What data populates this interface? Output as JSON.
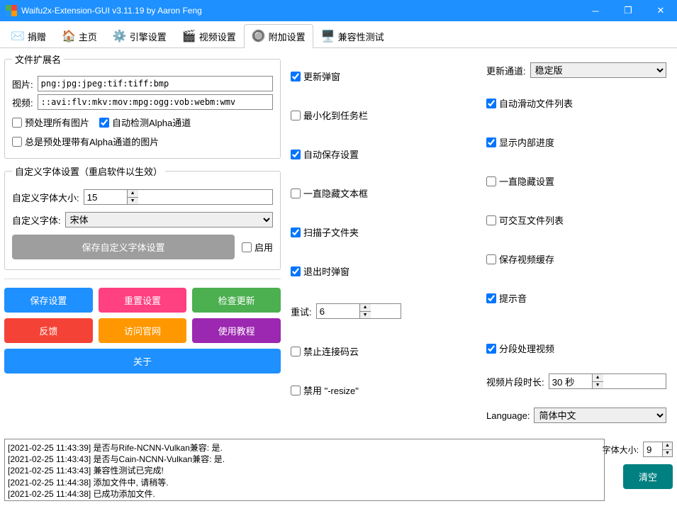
{
  "window": {
    "title": "Waifu2x-Extension-GUI v3.11.19 by Aaron Feng"
  },
  "tabs": {
    "donate": "捐赠",
    "home": "主页",
    "engine": "引擎设置",
    "video": "视频设置",
    "additional": "附加设置",
    "compat": "兼容性测试"
  },
  "fileExt": {
    "legend": "文件扩展名",
    "imageLabel": "图片:",
    "imageValue": "png:jpg:jpeg:tif:tiff:bmp",
    "videoLabel": "视频:",
    "videoValue": "::avi:flv:mkv:mov:mpg:ogg:vob:webm:wmv",
    "preprocessAll": "预处理所有图片",
    "autoAlpha": "自动检测Alpha通道",
    "alwaysAlpha": "总是预处理带有Alpha通道的图片"
  },
  "font": {
    "legend": "自定义字体设置（重启软件以生效）",
    "sizeLabel": "自定义字体大小:",
    "sizeValue": "15",
    "familyLabel": "自定义字体:",
    "familyValue": "宋体",
    "saveBtn": "保存自定义字体设置",
    "enable": "启用"
  },
  "buttons": {
    "saveSettings": "保存设置",
    "resetSettings": "重置设置",
    "checkUpdate": "检查更新",
    "feedback": "反馈",
    "visitSite": "访问官网",
    "tutorial": "使用教程",
    "about": "关于",
    "clear": "清空"
  },
  "col2": {
    "updatePopup": "更新弹窗",
    "minToTray": "最小化到任务栏",
    "autoSave": "自动保存设置",
    "hideTextBox": "一直隐藏文本框",
    "scanSubfolder": "扫描子文件夹",
    "exitPopup": "退出时弹窗",
    "retryLabel": "重试:",
    "retryValue": "6",
    "blockGitee": "禁止连接码云",
    "disableResize": "禁用 \"-resize\""
  },
  "col3": {
    "updateChannelLabel": "更新通道:",
    "updateChannelValue": "稳定版",
    "autoScrollList": "自动滑动文件列表",
    "showInternalProgress": "显示内部进度",
    "alwaysHideSettings": "一直隐藏设置",
    "interactiveFileList": "可交互文件列表",
    "keepVideoCache": "保存视频缓存",
    "promptSound": "提示音",
    "segmentVideo": "分段处理视频",
    "segmentDurationLabel": "视频片段时长:",
    "segmentDurationValue": "30 秒",
    "languageLabel": "Language:",
    "languageValue": "简体中文"
  },
  "log": {
    "l1": "[2021-02-25 11:43:39] 是否与Rife-NCNN-Vulkan兼容: 是.",
    "l2": "[2021-02-25 11:43:43] 是否与Cain-NCNN-Vulkan兼容: 是.",
    "l3": "[2021-02-25 11:43:43] 兼容性测试已完成!",
    "l4": "[2021-02-25 11:44:38] 添加文件中, 请稍等.",
    "l5": "[2021-02-25 11:44:38] 已成功添加文件."
  },
  "bottom": {
    "fontSizeLabel": "字体大小:",
    "fontSizeValue": "9"
  }
}
